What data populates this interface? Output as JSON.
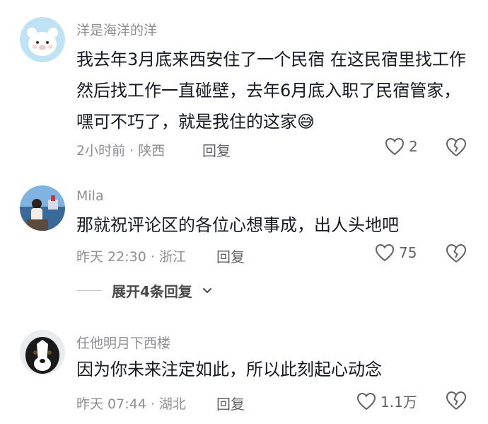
{
  "comments": [
    {
      "username": "洋是海洋的洋",
      "text": "我去年3月底来西安住了一个民宿 在这民宿里找工作 然后找工作一直碰壁，去年6月底入职了民宿管家，嘿可不巧了，就是我住的这家😅",
      "meta": "2小时前 · 陕西",
      "reply_label": "回复",
      "like_count": "2",
      "avatar": "bear-avatar-icon"
    },
    {
      "username": "Mila",
      "text": "那就祝评论区的各位心想事成，出人头地吧",
      "meta": "昨天 22:30 · 浙江",
      "reply_label": "回复",
      "like_count": "75",
      "avatar": "photo-avatar-icon"
    },
    {
      "username": "任他明月下西楼",
      "text": "因为你未来注定如此，所以此刻起心动念",
      "meta": "昨天 07:44 · 湖北",
      "reply_label": "回复",
      "like_count": "1.1万",
      "avatar": "dog-avatar-icon"
    }
  ],
  "expand_replies": {
    "label": "展开4条回复",
    "icon": "chevron-down-icon"
  },
  "colors": {
    "text": "#161823",
    "muted": "#8e8e93",
    "action": "#606266"
  }
}
